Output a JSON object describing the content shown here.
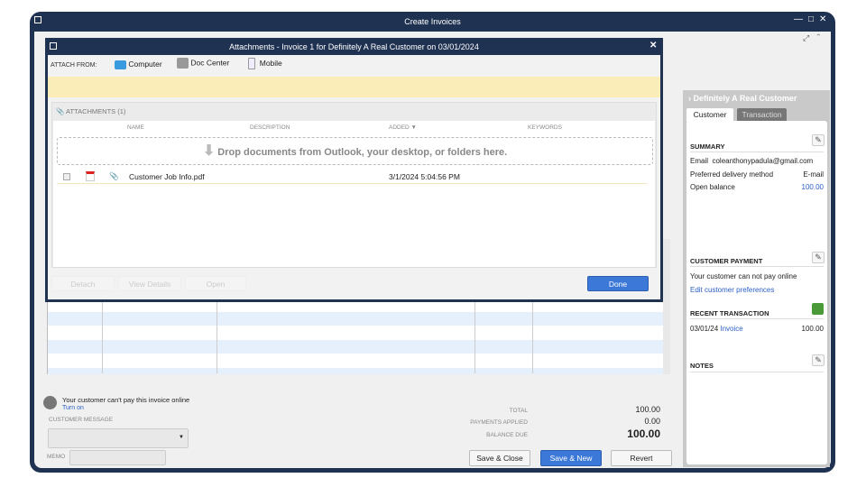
{
  "window": {
    "title": "Create Invoices"
  },
  "dialog": {
    "title": "Attachments - Invoice 1 for Definitely A Real Customer on 03/01/2024",
    "attach_from_label": "ATTACH FROM:",
    "sources": [
      {
        "label": "Computer",
        "icon": "folder-icon"
      },
      {
        "label": "Doc Center",
        "icon": "doc-center-icon"
      },
      {
        "label": "Mobile",
        "icon": "mobile-icon"
      }
    ],
    "attachments_header": "ATTACHMENTS (1)",
    "columns": [
      "NAME",
      "DESCRIPTION",
      "ADDED ▼",
      "KEYWORDS"
    ],
    "drop_hint": "Drop documents from Outlook, your desktop, or folders here.",
    "rows": [
      {
        "name": "Customer Job Info.pdf",
        "description": "",
        "added": "3/1/2024 5:04:56 PM",
        "keywords": ""
      }
    ],
    "buttons": {
      "detach": "Detach",
      "view_details": "View Details",
      "open": "Open",
      "done": "Done"
    }
  },
  "customer_panel": {
    "title": "Definitely A Real Customer",
    "tabs": [
      "Customer",
      "Transaction"
    ],
    "summary": {
      "heading": "SUMMARY",
      "email_label": "Email",
      "email": "coleanthonypadula@gmail.com",
      "delivery_label": "Preferred delivery method",
      "delivery": "E-mail",
      "balance_label": "Open balance",
      "balance": "100.00"
    },
    "payment": {
      "heading": "CUSTOMER PAYMENT",
      "text": "Your customer can not pay online",
      "link": "Edit customer preferences"
    },
    "recent": {
      "heading": "RECENT TRANSACTION",
      "date": "03/01/24",
      "type": "Invoice",
      "amount": "100.00"
    },
    "notes": {
      "heading": "NOTES"
    }
  },
  "footer": {
    "online_msg": "Your customer can't pay this invoice online",
    "turn_on": "Turn on",
    "customer_message_label": "CUSTOMER MESSAGE",
    "memo_label": "MEMO",
    "total_label": "TOTAL",
    "total": "100.00",
    "payments_label": "PAYMENTS APPLIED",
    "payments": "0.00",
    "balance_label": "BALANCE DUE",
    "balance": "100.00",
    "save_close": "Save & Close",
    "save_new": "Save & New",
    "revert": "Revert"
  }
}
